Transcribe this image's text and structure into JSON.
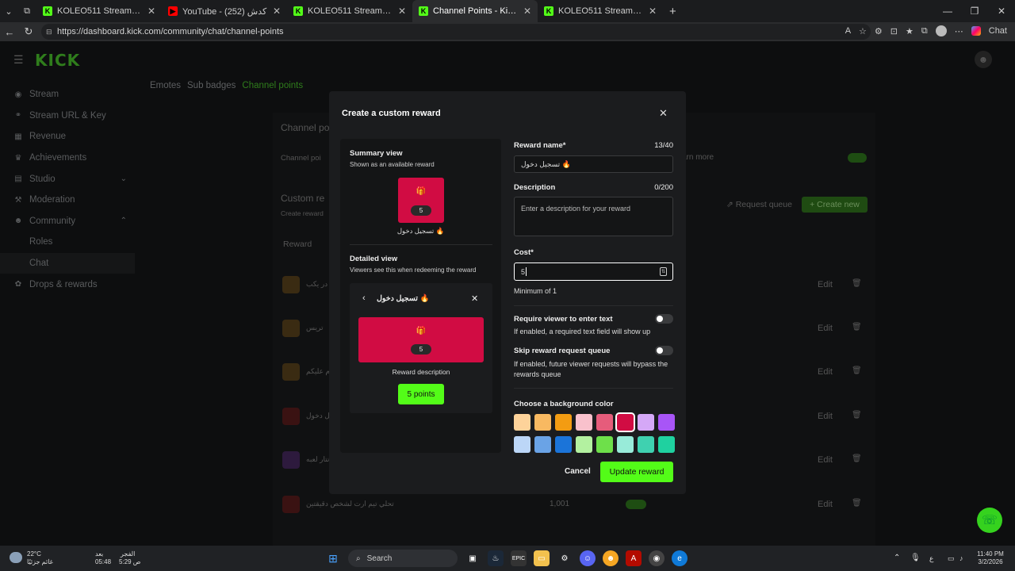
{
  "browser": {
    "tabs": [
      {
        "title": "KOLEO511 Stream - Watch Live on",
        "color": "#53fc18",
        "active": false
      },
      {
        "title": "YouTube - كدش (252)",
        "color": "#ff0000",
        "active": false
      },
      {
        "title": "KOLEO511 Stream - Watch Live on",
        "color": "#53fc18",
        "active": false
      },
      {
        "title": "Channel Points - Kick Dashboard",
        "color": "#53fc18",
        "active": true
      },
      {
        "title": "KOLEO511 Stream - Kick Dashboar",
        "color": "#53fc18",
        "active": false
      }
    ],
    "url": "https://dashboard.kick.com/community/chat/channel-points",
    "copilot_label": "Chat"
  },
  "app": {
    "logo": "KICK",
    "sidebar": [
      {
        "label": "Stream",
        "icon": "stream-icon"
      },
      {
        "label": "Stream URL & Key",
        "icon": "link-icon"
      },
      {
        "label": "Revenue",
        "icon": "revenue-icon"
      },
      {
        "label": "Achievements",
        "icon": "trophy-icon"
      },
      {
        "label": "Studio",
        "icon": "grid-icon",
        "chevron": "⌄"
      },
      {
        "label": "Moderation",
        "icon": "hammer-icon"
      },
      {
        "label": "Community",
        "icon": "people-icon",
        "chevron": "⌃"
      },
      {
        "label": "Roles",
        "sub": true
      },
      {
        "label": "Chat",
        "sub": true,
        "selected": true
      },
      {
        "label": "Drops & rewards",
        "icon": "gift-icon"
      }
    ],
    "topnav": [
      "Emotes",
      "Sub badges",
      "Channel points"
    ],
    "bg": {
      "channel_title": "Channel po",
      "channel_points_label": "Channel poi",
      "learn_more": "arn more",
      "custom_rewards": "Custom re",
      "create_rewards": "Create reward",
      "request_queue": "Request queue",
      "create_new": "Create new",
      "reward_col": "Reward",
      "rows": [
        {
          "name": "در يكب",
          "edit": "Edit"
        },
        {
          "name": "تريس",
          "edit": "Edit"
        },
        {
          "name": "لام عليكم",
          "edit": "Edit"
        },
        {
          "name": "تسجيل دخول",
          "edit": "Edit"
        },
        {
          "name": "نتار لعبه",
          "edit": "Edit"
        },
        {
          "name": "تحلي تيم ارت لشخص دقيقتين",
          "cost": "1,001",
          "edit": "Edit"
        }
      ]
    }
  },
  "modal": {
    "title": "Create a custom reward",
    "summary": {
      "heading": "Summary view",
      "sub": "Shown as an available reward",
      "cost": "5",
      "name": "تسجيل دخول 🔥"
    },
    "detailed": {
      "heading": "Detailed view",
      "sub": "Viewers see this when redeeming the reward",
      "name": "تسجيل دخول 🔥",
      "cost": "5",
      "description": "Reward description",
      "button": "5 points"
    },
    "form": {
      "reward_name_label": "Reward name*",
      "reward_name_count": "13/40",
      "reward_name_value": "تسجيل دخول 🔥",
      "description_label": "Description",
      "description_count": "0/200",
      "description_placeholder": "Enter a description for your reward",
      "cost_label": "Cost*",
      "cost_value": "5",
      "cost_hint": "Minimum of 1",
      "require_text_label": "Require viewer to enter text",
      "require_text_hint": "If enabled, a required text field will show up",
      "skip_queue_label": "Skip reward request queue",
      "skip_queue_hint": "If enabled, future viewer requests will bypass the rewards queue",
      "color_label": "Choose a background color",
      "colors": [
        "#fdd39a",
        "#f8b961",
        "#f39c12",
        "#f9c1cc",
        "#e65c7b",
        "#d10c43",
        "#d5a8f7",
        "#a855f7",
        "#bcd6f7",
        "#6aa3e6",
        "#1b74d9",
        "#b3f1a0",
        "#6ee04a",
        "#98ebd9",
        "#3fd1b0",
        "#1fd1a0"
      ],
      "selected_color": "#d10c43",
      "cancel": "Cancel",
      "submit": "Update reward"
    }
  },
  "taskbar": {
    "weather_temp": "22°C",
    "weather_desc": "غائم جزئيًا",
    "prayer1_label": "بعد",
    "prayer1_time": "05:48",
    "prayer2_label": "الفجر",
    "prayer2_time": "5:29 ص",
    "search": "Search",
    "lang": "ع",
    "time": "11:40 PM",
    "date": "3/2/2026"
  }
}
